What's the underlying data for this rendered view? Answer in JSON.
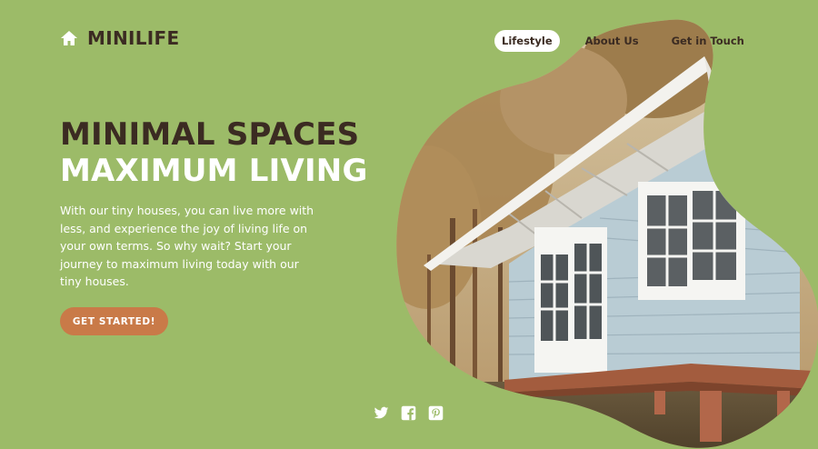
{
  "brand": {
    "name": "MINILIFE",
    "icon": "home-icon"
  },
  "nav": {
    "items": [
      {
        "label": "Lifestyle",
        "active": true
      },
      {
        "label": "About Us",
        "active": false
      },
      {
        "label": "Get in Touch",
        "active": false
      }
    ]
  },
  "hero": {
    "title_line1": "MINIMAL SPACES",
    "title_line2": "MAXIMUM LIVING",
    "description": "With our tiny houses, you can live more with less, and experience the joy of living life on your own terms. So why wait? Start your journey to maximum living today with our tiny houses.",
    "cta_label": "GET STARTED!"
  },
  "social": {
    "icons": [
      "twitter-icon",
      "facebook-icon",
      "pinterest-icon"
    ]
  },
  "colors": {
    "background": "#9cbb68",
    "dark_text": "#3b2b22",
    "accent": "#c97a48",
    "white": "#ffffff"
  }
}
